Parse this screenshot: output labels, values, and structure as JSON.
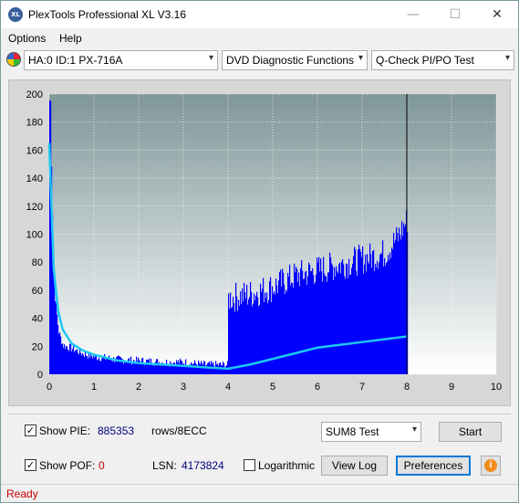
{
  "window": {
    "title": "PlexTools Professional XL V3.16",
    "icon_text": "XL",
    "minimize": "—",
    "maximize": "☐",
    "close": "✕"
  },
  "menu": [
    "Options",
    "Help"
  ],
  "toolbar": {
    "drive": "HA:0 ID:1  PX-716A",
    "function": "DVD Diagnostic Functions",
    "test": "Q-Check PI/PO Test"
  },
  "chart_data": {
    "type": "area",
    "xlim": [
      0,
      10
    ],
    "ylim": [
      0,
      200
    ],
    "x_ticks": [
      "0",
      "1",
      "2",
      "3",
      "4",
      "5",
      "6",
      "7",
      "8",
      "9",
      "10"
    ],
    "y_ticks": [
      "0",
      "20",
      "40",
      "60",
      "80",
      "100",
      "120",
      "140",
      "160",
      "180",
      "200"
    ],
    "grid": true,
    "end_marker_x": 8,
    "series": [
      {
        "kind": "bars",
        "color": "#0000ff",
        "x": [
          0.02,
          0.05,
          0.08,
          0.12,
          0.2,
          0.3,
          0.5,
          0.75,
          1.0,
          1.5,
          2.0,
          2.5,
          3.0,
          3.5,
          3.98,
          4.0,
          4.5,
          5.0,
          5.5,
          6.0,
          6.5,
          7.0,
          7.5,
          7.8,
          8.0
        ],
        "y": [
          195,
          130,
          90,
          55,
          30,
          20,
          18,
          14,
          12,
          10,
          9,
          8,
          8,
          6,
          6,
          52,
          55,
          60,
          68,
          72,
          76,
          80,
          84,
          96,
          108
        ]
      },
      {
        "kind": "line",
        "color": "#1ec8f0",
        "x": [
          0.0,
          0.05,
          0.1,
          0.2,
          0.3,
          0.5,
          0.75,
          1.0,
          1.5,
          2.0,
          2.5,
          3.0,
          3.5,
          4.0,
          4.5,
          5.0,
          5.5,
          6.0,
          6.5,
          7.0,
          7.5,
          8.0
        ],
        "y": [
          165,
          120,
          75,
          45,
          32,
          22,
          17,
          14,
          10,
          8,
          7,
          6,
          5,
          4,
          7,
          11,
          15,
          19,
          21,
          23,
          25,
          27
        ]
      }
    ]
  },
  "controls": {
    "show_pie_label": "Show PIE:",
    "pie_value": "885353",
    "rows_label": "rows/8ECC",
    "show_pof_label": "Show POF:",
    "pof_value": "0",
    "lsn_label": "LSN:",
    "lsn_value": "4173824",
    "logarithmic_label": "Logarithmic",
    "sum_select": "SUM8 Test",
    "start": "Start",
    "view_log": "View Log",
    "preferences": "Preferences",
    "info_icon": "i",
    "check_mark": "✓"
  },
  "status": "Ready",
  "colors": {
    "plot_bg_top": "#7f9799",
    "plot_bg_bottom": "#ffffff",
    "bars": "#0000ff",
    "line": "#1ec8f0",
    "pie_value": "#000080",
    "pof_value": "#c00000",
    "status": "#c00000"
  }
}
